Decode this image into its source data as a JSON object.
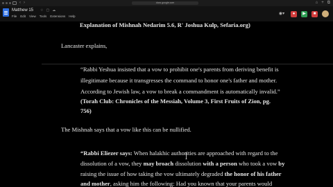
{
  "browser": {
    "url": "docs.google.com",
    "back_glyph": "‹",
    "forward_glyph": "›",
    "right_glyphs": [
      "⌂",
      "+",
      "⧉"
    ]
  },
  "docs": {
    "title": "Matthew 15",
    "title_icons": [
      "☆",
      "▢",
      "☁"
    ],
    "menu": [
      "File",
      "Edit",
      "View",
      "Tools",
      "Extensions",
      "Help"
    ],
    "header_icons": [
      "visibility-icon",
      "record-icon",
      "meet-icon",
      "chat-icon",
      "profile-avatar"
    ],
    "doc_controls": [
      "⌃",
      "⊡"
    ]
  },
  "document": {
    "line1": "Explanation of Mishnah Nedarim 5.6, R' Joshua Kulp, Sefaria.org)",
    "line2": "Lancaster explains,",
    "quote": [
      "“Rabbi Yeshua insisted that a vow to prohibit one's parents from deriving benefit is",
      "illegitimate because it transgresses the command to honor one's father and mother.",
      "According to Jewish law, a vow to break a commandment is automatically invalid.”"
    ],
    "citation": [
      "(Torah Club: Chronicles of the Messiah, Volume 3, First Fruits of Zion, pg.",
      "756)"
    ],
    "mishnah_line": "The Mishnah says that a vow like this can be nullified.",
    "p3": {
      "l1_bold": "“Rabbi Eliezer says:",
      "l1_rest": " When halakhic authorities are approached with regard to the",
      "l2_a": "dissolution of a vow, they ",
      "l2_b": "may broach",
      "l2_c": " dissolution ",
      "l2_d": "with a person",
      "l2_e": " who took a vow ",
      "l2_f": "by",
      "l3_a": "raising the issue of how taking the vow ultimately degraded ",
      "l3_b": "the honor of his father",
      "l4_a": "and mother",
      "l4_b": ", asking him the following: Had you known that your parents would"
    }
  }
}
